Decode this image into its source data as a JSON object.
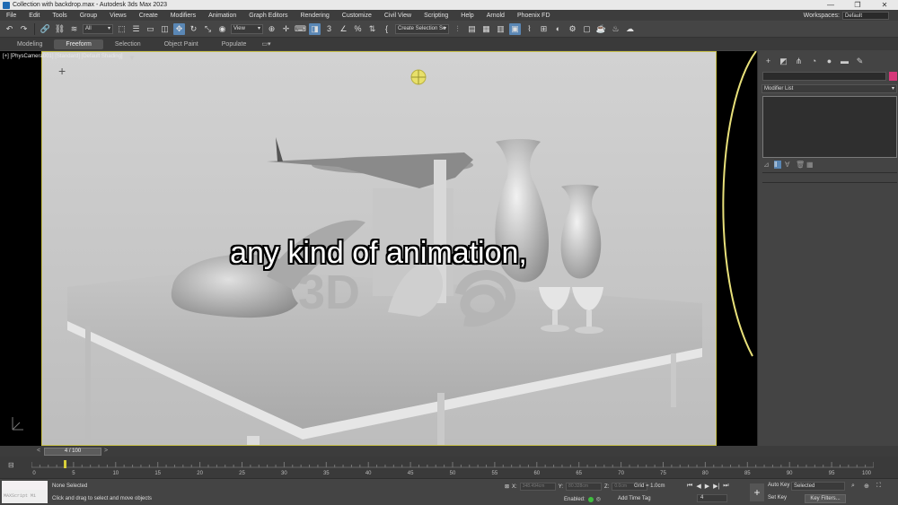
{
  "window": {
    "title": "Collection with backdrop.max - Autodesk 3ds Max 2023",
    "buttons": [
      "—",
      "❐",
      "✕"
    ]
  },
  "menu": {
    "items": [
      "File",
      "Edit",
      "Tools",
      "Group",
      "Views",
      "Create",
      "Modifiers",
      "Animation",
      "Graph Editors",
      "Rendering",
      "Customize",
      "Civil View",
      "Scripting",
      "Help",
      "Arnold",
      "Phoenix FD"
    ],
    "workspaces_label": "Workspaces:",
    "workspaces_value": "Default"
  },
  "toolbar": {
    "selection_filter": "All",
    "ref_coord": "View",
    "named_selection": "Create Selection Se"
  },
  "ribbon": {
    "tabs": [
      "Modeling",
      "Freeform",
      "Selection",
      "Object Paint",
      "Populate"
    ],
    "active": "Freeform"
  },
  "viewport": {
    "label": "[+] [PhysCamera001] [Standard] [Default Shading]",
    "subtitle": "any kind of animation,"
  },
  "command_panel": {
    "modifier_list": "Modifier List",
    "colors": {
      "object_color": "#d6387a"
    }
  },
  "time_slider": {
    "position": "4 / 100",
    "prev": "<",
    "next": ">",
    "current_frame": 4,
    "total_frames": 100
  },
  "track_bar": {
    "ticks": [
      "0",
      "5",
      "10",
      "15",
      "20",
      "25",
      "30",
      "35",
      "40",
      "45",
      "50",
      "55",
      "60",
      "65",
      "70",
      "75",
      "80",
      "85",
      "90",
      "95",
      "100"
    ]
  },
  "status": {
    "maxscript_placeholder": "MAXScript Mi",
    "selection": "None Selected",
    "prompt": "Click and drag to select and move objects",
    "x_label": "X:",
    "x_value": "348.494cm",
    "y_label": "Y:",
    "y_value": "80.328cm",
    "z_label": "Z:",
    "z_value": "0.0cm",
    "grid": "Grid = 1.0cm",
    "enabled_label": "Enabled:",
    "add_time_tag": "Add Time Tag",
    "frame": "4",
    "auto_key": "Auto Key",
    "set_key": "Set Key",
    "selected": "Selected",
    "key_filters": "Key Filters..."
  }
}
